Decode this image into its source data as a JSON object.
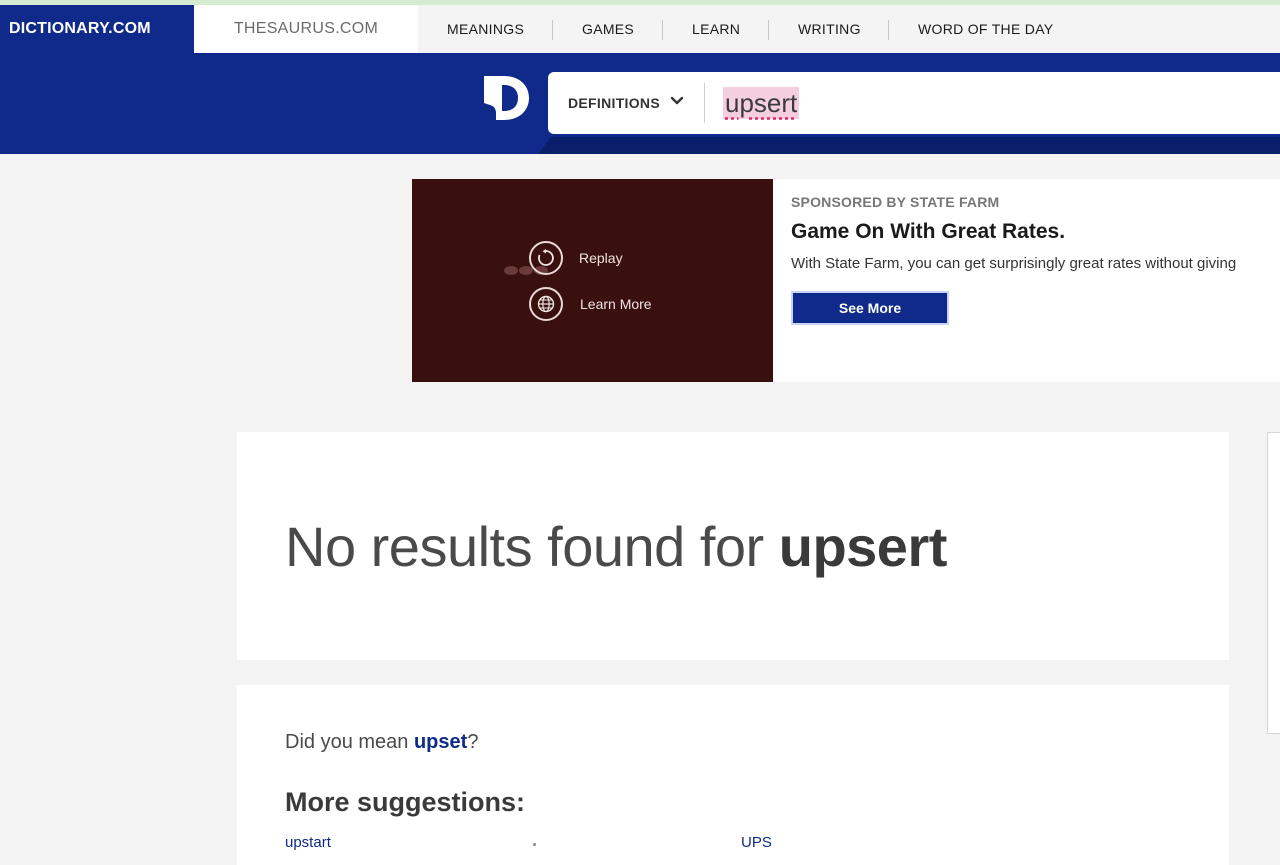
{
  "topnav": {
    "brand": "DICTIONARY.COM",
    "thesaurus": "THESAURUS.COM",
    "items": [
      "MEANINGS",
      "GAMES",
      "LEARN",
      "WRITING",
      "WORD OF THE DAY"
    ]
  },
  "search": {
    "mode": "DEFINITIONS",
    "value": "upsert"
  },
  "ad": {
    "replay_label": "Replay",
    "learn_more_label": "Learn More",
    "sponsor": "SPONSORED BY STATE FARM",
    "title": "Game On With Great Rates.",
    "description": "With State Farm, you can get surprisingly great rates without giving",
    "cta": "See More"
  },
  "results": {
    "prefix": "No results found for ",
    "term": "upsert"
  },
  "suggestions": {
    "did_you_mean_prefix": "Did you mean ",
    "did_you_mean_word": "upset",
    "did_you_mean_suffix": "?",
    "more_title": "More suggestions:",
    "items": [
      "upstart",
      "UPS"
    ]
  },
  "colors": {
    "brand_blue": "#0f2a8a",
    "ad_video_bg": "#39100e",
    "page_bg": "#f3f3f3"
  },
  "icons": [
    "dictionary-logo-icon",
    "chevron-down-icon",
    "replay-icon",
    "globe-icon"
  ]
}
